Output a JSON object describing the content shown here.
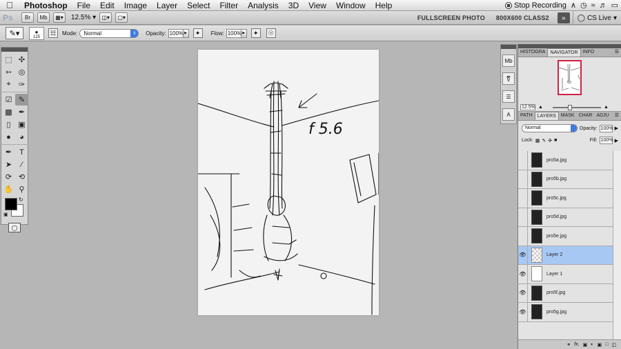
{
  "menubar": {
    "apple": "",
    "app_name": "Photoshop",
    "items": [
      "File",
      "Edit",
      "Image",
      "Layer",
      "Select",
      "Filter",
      "Analysis",
      "3D",
      "View",
      "Window",
      "Help"
    ],
    "stop_recording": "Stop Recording"
  },
  "appbar": {
    "logo": "Ps",
    "zoom": "12.5%",
    "workspace_1": "FULLSCREEN PHOTO",
    "workspace_2": "800X600 CLASS2",
    "expand": "»",
    "cs_live": "CS Live"
  },
  "options": {
    "brush_size": "125",
    "mode_label": "Mode:",
    "mode_value": "Normal",
    "opacity_label": "Opacity:",
    "opacity_value": "100%",
    "flow_label": "Flow:",
    "flow_value": "100%"
  },
  "navigator": {
    "tabs": [
      "HISTOGRA",
      "NAVIGATOR",
      "INFO"
    ],
    "zoom": "12.5%"
  },
  "layers": {
    "tabs": [
      "PATH",
      "LAYERS",
      "MASK",
      "CHAR",
      "ADJU"
    ],
    "blend_mode": "Normal",
    "opacity_label": "Opacity:",
    "opacity_value": "100%",
    "lock_label": "Lock:",
    "fill_label": "Fill:",
    "fill_value": "100%",
    "rows": [
      {
        "name": "pro5a.jpg",
        "visible": false
      },
      {
        "name": "pro5b.jpg",
        "visible": false
      },
      {
        "name": "pro5c.jpg",
        "visible": false
      },
      {
        "name": "pro5d.jpg",
        "visible": false
      },
      {
        "name": "pro5e.jpg",
        "visible": false
      },
      {
        "name": "Layer 2",
        "visible": true
      },
      {
        "name": "Layer 1",
        "visible": true
      },
      {
        "name": "pro5f.jpg",
        "visible": true
      },
      {
        "name": "pro5g.jpg",
        "visible": true
      }
    ],
    "footer_icons": [
      "link-icon",
      "fx-icon",
      "mask-icon",
      "adjustment-icon",
      "folder-icon",
      "new-layer-icon",
      "trash-icon"
    ]
  },
  "canvas_text": "f 5.6"
}
